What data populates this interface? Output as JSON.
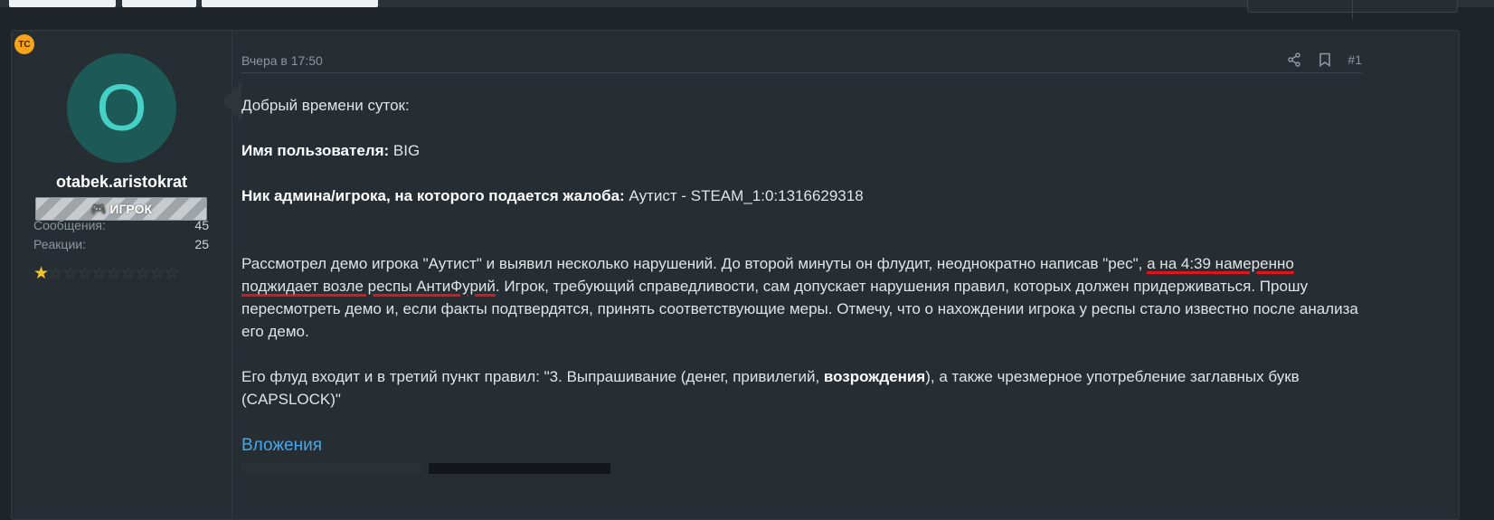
{
  "post": {
    "ts_badge": "ТС",
    "user": {
      "avatar_letter": "O",
      "name": "otabek.aristokrat",
      "role": "ИГРОК",
      "stats": [
        {
          "label": "Сообщения:",
          "value": "45"
        },
        {
          "label": "Реакции:",
          "value": "25"
        }
      ],
      "rating_stars": 1,
      "rating_max": 10
    },
    "date": "Вчера в 17:50",
    "number": "#1",
    "greeting": "Добрый времени суток:",
    "username_label": "Имя пользователя:",
    "username_value": " BIG",
    "target_label": "Ник админа/игрока, на которого подается жалоба:",
    "target_value": " Аутист - STEAM_1:0:1316629318",
    "para1_a": "Рассмотрел демо игрока \"Аутист\" и выявил несколько нарушений. До второй минуты он флудит, неоднократно написав \"рес\", ",
    "para1_underlined": "а на 4:39 намеренно поджидает возле респы АнтиФурий",
    "para1_b": ". Игрок, требующий справедливости, сам допускает нарушения правил, которых должен придерживаться. Прошу пересмотреть демо и, если факты подтвердятся, принять соответствующие меры. Отмечу, что о нахождении игрока у респы стало известно после анализа его демо.",
    "para2_a": "Его флуд входит и в третий пункт правил: \"3. Выпрашивание (денег, привилегий, ",
    "para2_bold": "возрождения",
    "para2_b": "), а также чрезмерное употребление заглавных букв (CAPSLOCK)\"",
    "attachments_title": "Вложения"
  }
}
